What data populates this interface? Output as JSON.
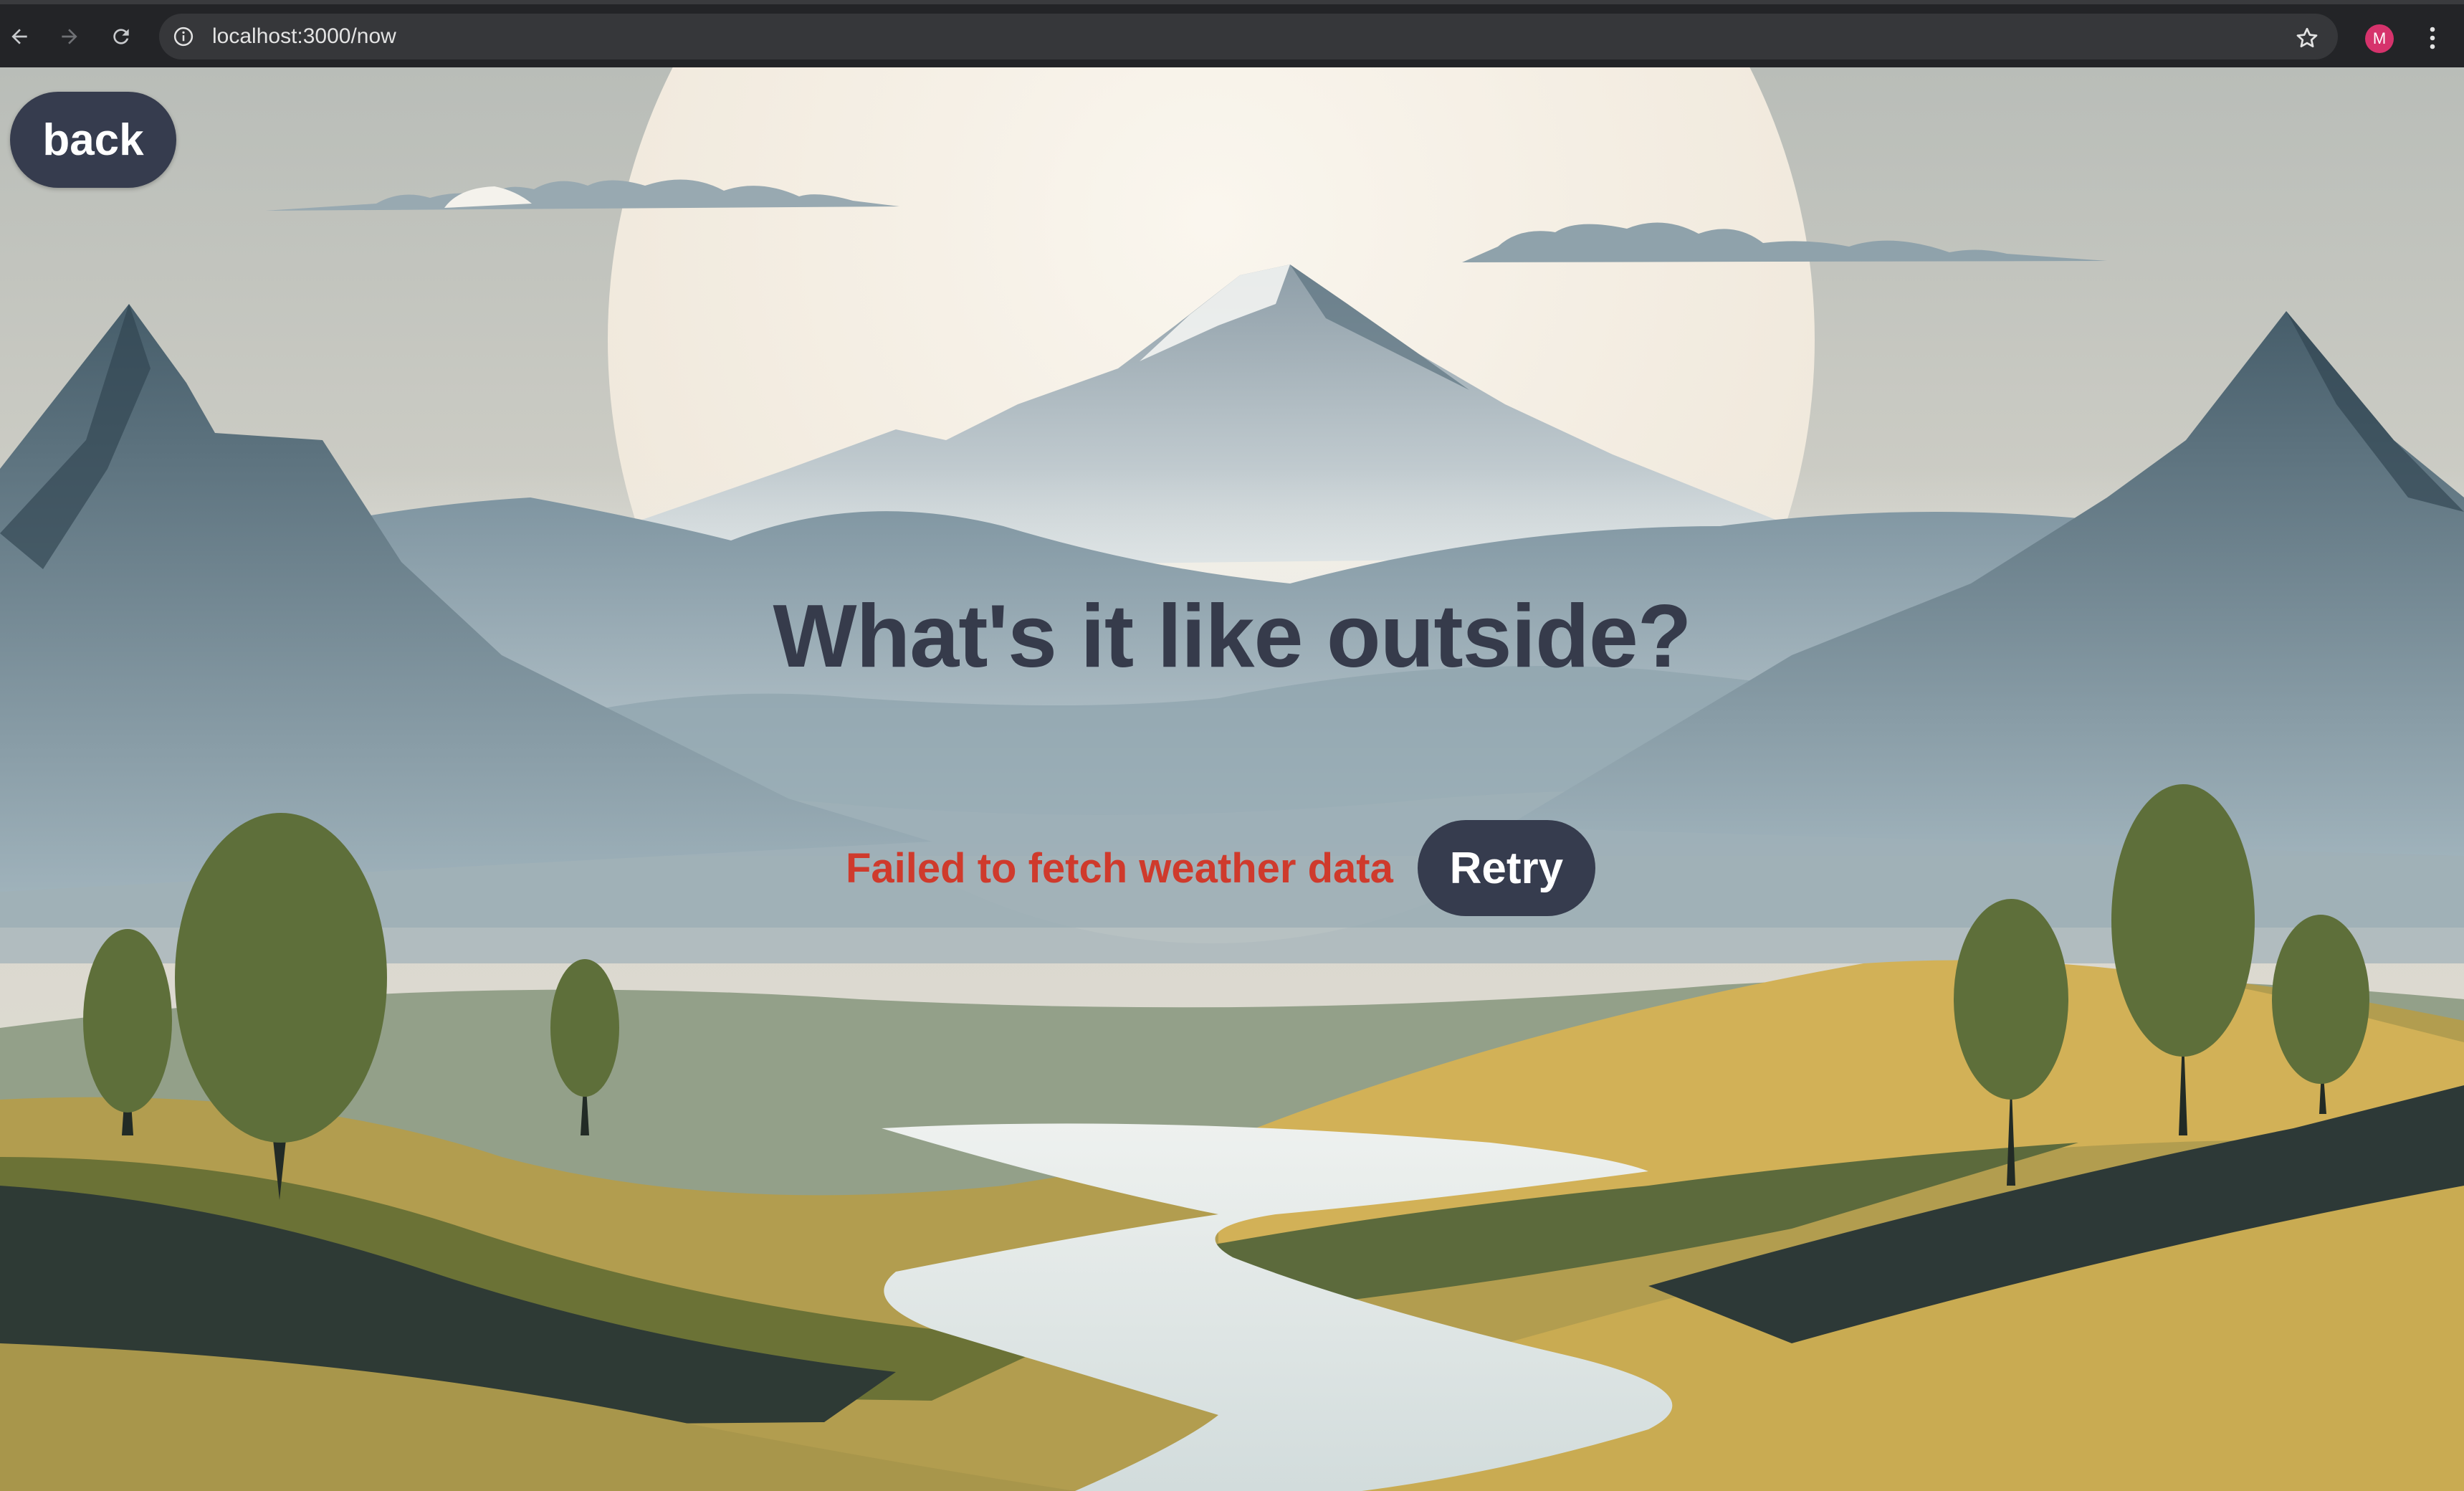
{
  "browser": {
    "url": "localhost:3000/now",
    "profile_initial": "M",
    "profile_color": "#d6336c",
    "icons": {
      "back": "arrow-left-icon",
      "forward": "arrow-right-icon",
      "reload": "reload-icon",
      "site_info": "info-icon",
      "bookmark": "star-icon",
      "menu": "kebab-menu-icon"
    }
  },
  "page": {
    "back_label": "back",
    "headline": "What's it like outside?",
    "error_message": "Failed to fetch weather data",
    "retry_label": "Retry",
    "colors": {
      "button_bg": "#363c4e",
      "headline": "#363b4b",
      "error": "#cf3a2c"
    }
  }
}
